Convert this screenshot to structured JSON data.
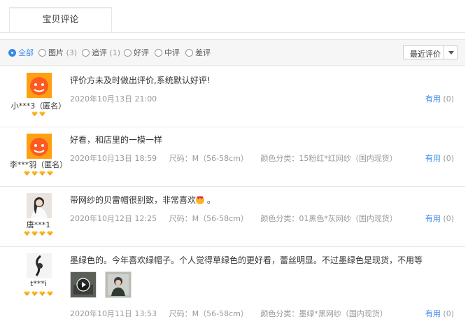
{
  "tabs": {
    "active_label": "宝贝评论"
  },
  "filters": [
    {
      "label": "全部",
      "count": "",
      "selected": true
    },
    {
      "label": "图片",
      "count": "(3)",
      "selected": false
    },
    {
      "label": "追评",
      "count": "(1)",
      "selected": false
    },
    {
      "label": "好评",
      "count": "",
      "selected": false
    },
    {
      "label": "中评",
      "count": "",
      "selected": false
    },
    {
      "label": "差评",
      "count": "",
      "selected": false
    }
  ],
  "sort": {
    "label": "最近评价"
  },
  "reviews": [
    {
      "user": "小***3（匿名）",
      "content": "评价方未及时做出评价,系统默认好评!",
      "date": "2020年10月13日 21:00",
      "size": "",
      "color": "",
      "useful_label": "有用",
      "useful_count": "(0)"
    },
    {
      "user": "李***羽（匿名）",
      "content": "好看，和店里的一模一样",
      "date": "2020年10月13日 18:59",
      "size": "尺码：M（56-58cm）",
      "color": "颜色分类：15粉红*红网纱（国内现货）",
      "useful_label": "有用",
      "useful_count": "(0)"
    },
    {
      "user": "唐***1",
      "content": "带网纱的贝雷帽很别致，非常喜欢",
      "content_tail": "。",
      "date": "2020年10月12日 12:25",
      "size": "尺码：M（56-58cm）",
      "color": "颜色分类：01黑色*灰网纱（国内现货）",
      "useful_label": "有用",
      "useful_count": "(0)"
    },
    {
      "user": "t***i",
      "content": "墨绿色的。今年喜欢绿帽子。个人觉得草绿色的更好看，蕾丝明显。不过墨绿色是现货，不用等",
      "date": "2020年10月11日 13:53",
      "size": "尺码：M（56-58cm）",
      "color": "颜色分类：墨绿*黑网纱（国内现货）",
      "useful_label": "有用",
      "useful_count": "(0)"
    }
  ],
  "colors": {
    "accent": "#3a88e8",
    "muted": "#999999",
    "rank": "#f5a300"
  }
}
